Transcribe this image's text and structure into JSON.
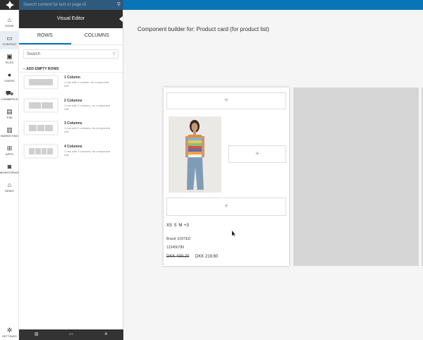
{
  "topbar": {
    "search_placeholder": "Search content for text or page id"
  },
  "nav": {
    "items": [
      {
        "label": "HOME",
        "icon": "home-icon",
        "glyph": "⌂"
      },
      {
        "label": "CONTENT",
        "icon": "monitor-icon",
        "glyph": "▭"
      },
      {
        "label": "FILES",
        "icon": "briefcase-icon",
        "glyph": "▣"
      },
      {
        "label": "USERS",
        "icon": "user-icon",
        "glyph": "●"
      },
      {
        "label": "COMMERCE",
        "icon": "cart-icon",
        "glyph": "⛟"
      },
      {
        "label": "PIM",
        "icon": "book-icon",
        "glyph": "▤"
      },
      {
        "label": "MARKETING",
        "icon": "chart-icon",
        "glyph": "▥"
      },
      {
        "label": "APPS",
        "icon": "grid-icon",
        "glyph": "⊞"
      },
      {
        "label": "MONITORING",
        "icon": "camera-icon",
        "glyph": "◙"
      },
      {
        "label": "DEMO",
        "icon": "house-icon",
        "glyph": "⌂"
      }
    ],
    "settings": {
      "label": "SETTINGS",
      "icon": "gear-icon",
      "glyph": "✲"
    }
  },
  "panel": {
    "title": "Visual Editor",
    "tabs": [
      "ROWS",
      "COLUMNS"
    ],
    "search_placeholder": "Search",
    "section_title": "ADD EMPTY ROWS",
    "rows": [
      {
        "name": "1 Column",
        "desc": "1 row with 1 column, for component edit",
        "cols": 1
      },
      {
        "name": "2 Columns",
        "desc": "1 row with 2 columns, for component edit",
        "cols": 2
      },
      {
        "name": "3 Columns",
        "desc": "1 row with 3 columns, for component edit",
        "cols": 3
      },
      {
        "name": "4 Columns",
        "desc": "1 row with 4 columns, for component edit",
        "cols": 4
      }
    ],
    "footer_icons": [
      "image-icon",
      "monitor-icon",
      "sitemap-icon"
    ]
  },
  "main": {
    "title": "Component builder for: Product card (for product list)",
    "card": {
      "plus": "+",
      "sizes": "XS  S  M  +3",
      "brand": "Brand: EDITED",
      "sku": "123456789",
      "price_old": "DKK 439,20",
      "price_new": "DKK 219,60"
    }
  }
}
